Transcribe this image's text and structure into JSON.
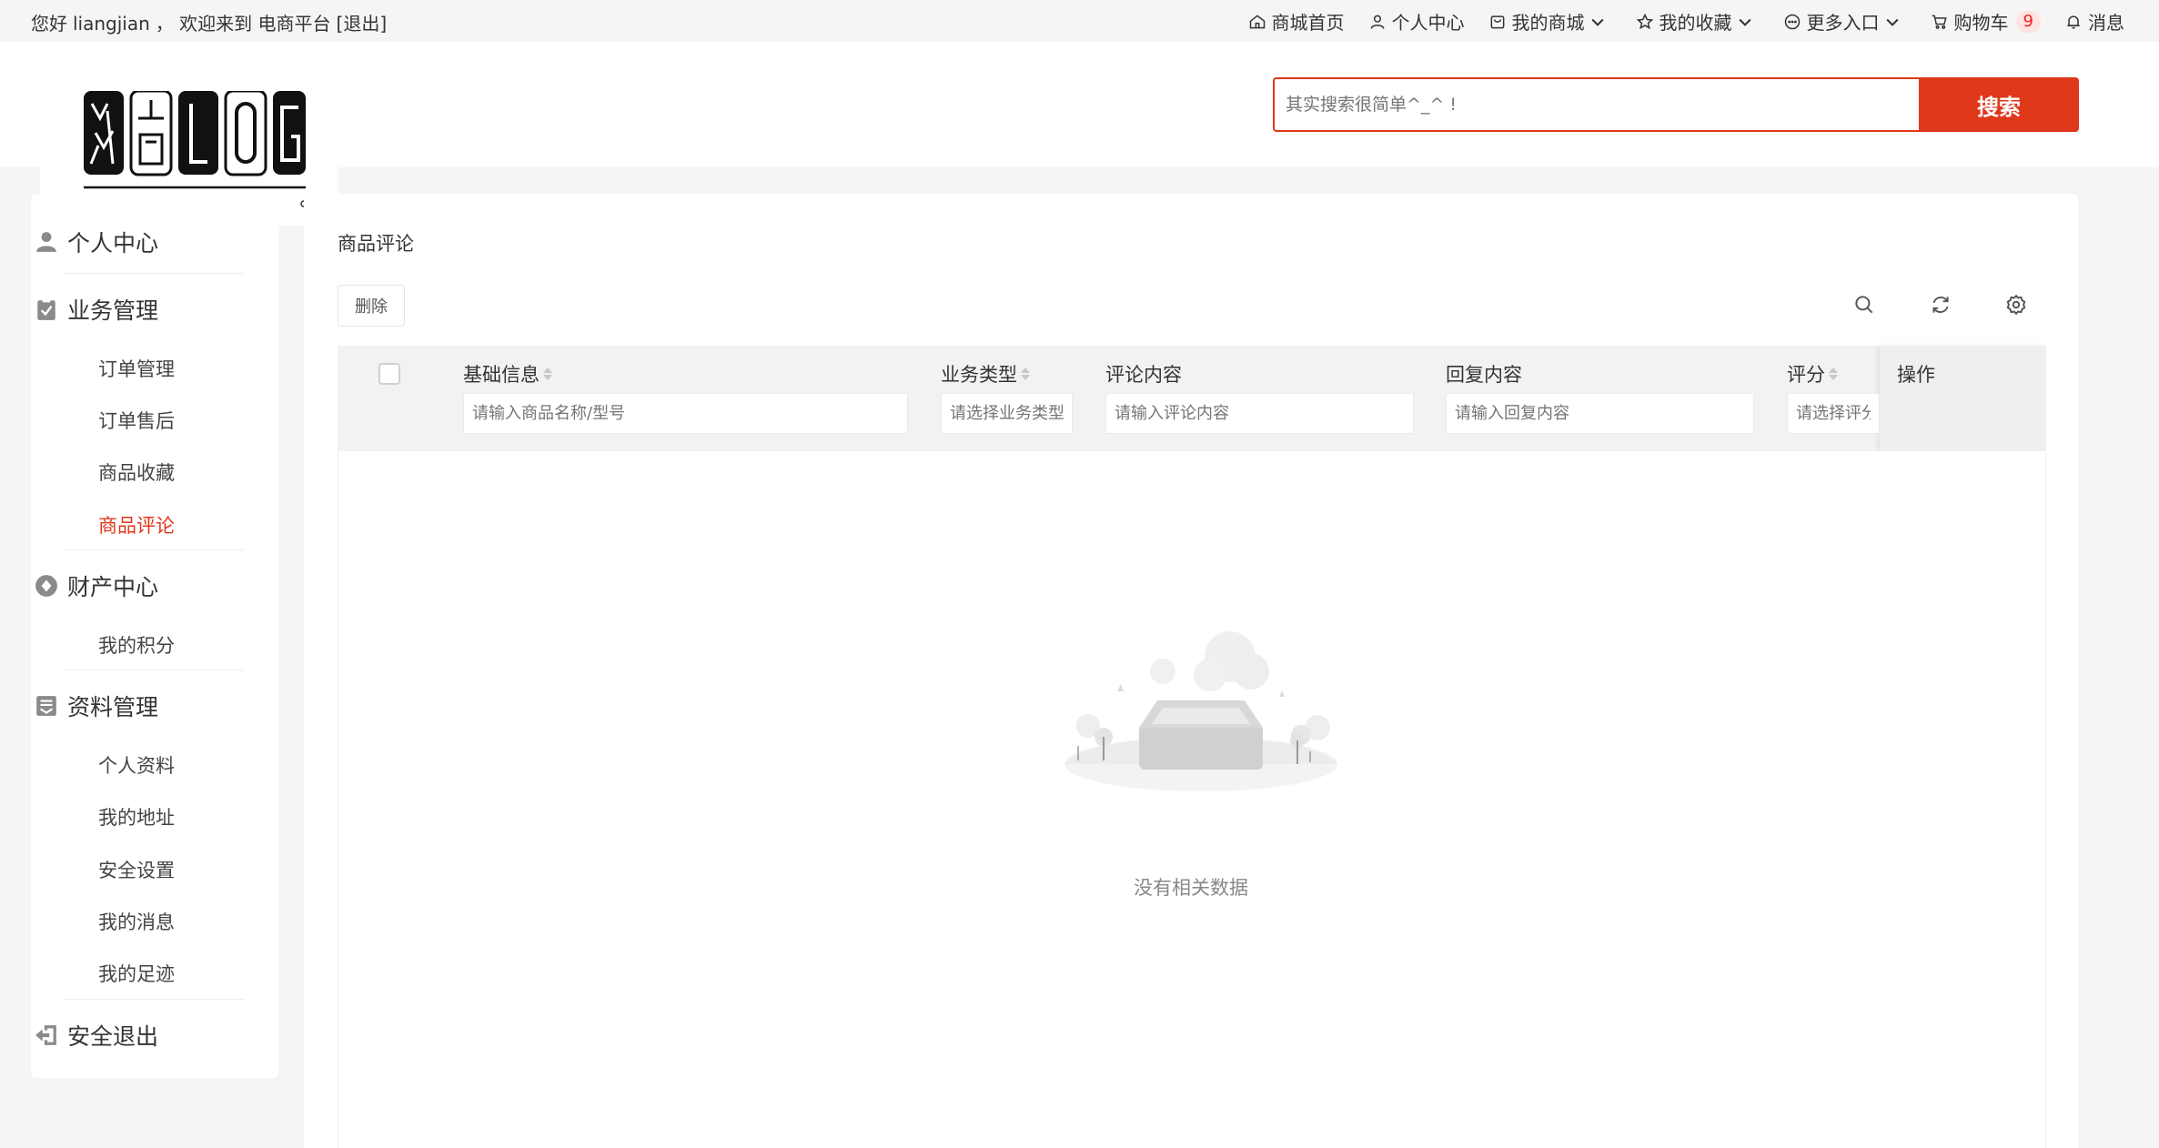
{
  "topbar": {
    "greeting_prefix": "您好",
    "username": "liangjian",
    "welcome": "，  欢迎来到 电商平台",
    "logout": "[退出]",
    "nav": [
      {
        "label": "商城首页",
        "icon": "home-icon"
      },
      {
        "label": "个人中心",
        "icon": "user-icon"
      },
      {
        "label": "我的商城",
        "icon": "shop-icon"
      },
      {
        "label": "我的收藏",
        "icon": "star-icon"
      },
      {
        "label": "更多入口",
        "icon": "more-icon"
      },
      {
        "label": "购物车",
        "icon": "cart-icon",
        "badge": "9"
      },
      {
        "label": "消息",
        "icon": "bell-icon"
      }
    ]
  },
  "header": {
    "search_placeholder": "其实搜索很简单^_^ !",
    "search_button": "搜索"
  },
  "sidebar": {
    "groups": [
      {
        "title": "个人中心",
        "icon": "user-icon",
        "items": []
      },
      {
        "title": "业务管理",
        "icon": "clipboard-icon",
        "items": [
          "订单管理",
          "订单售后",
          "商品收藏",
          "商品评论"
        ]
      },
      {
        "title": "财产中心",
        "icon": "diamond-icon",
        "items": [
          "我的积分"
        ]
      },
      {
        "title": "资料管理",
        "icon": "profile-icon",
        "items": [
          "个人资料",
          "我的地址",
          "安全设置",
          "我的消息",
          "我的足迹"
        ]
      },
      {
        "title": "安全退出",
        "icon": "logout-icon",
        "items": []
      }
    ],
    "active_item": "商品评论"
  },
  "main": {
    "title": "商品评论",
    "delete_button": "删除",
    "columns": [
      {
        "label": "基础信息",
        "sortable": true,
        "placeholder": "请输入商品名称/型号"
      },
      {
        "label": "业务类型",
        "sortable": true,
        "placeholder": "请选择业务类型"
      },
      {
        "label": "评论内容",
        "sortable": false,
        "placeholder": "请输入评论内容"
      },
      {
        "label": "回复内容",
        "sortable": false,
        "placeholder": "请输入回复内容"
      },
      {
        "label": "评分",
        "sortable": true,
        "placeholder": "请选择评分"
      },
      {
        "label": "操作",
        "sortable": false
      }
    ],
    "empty_text": "没有相关数据"
  },
  "colors": {
    "accent": "#e0381b"
  }
}
